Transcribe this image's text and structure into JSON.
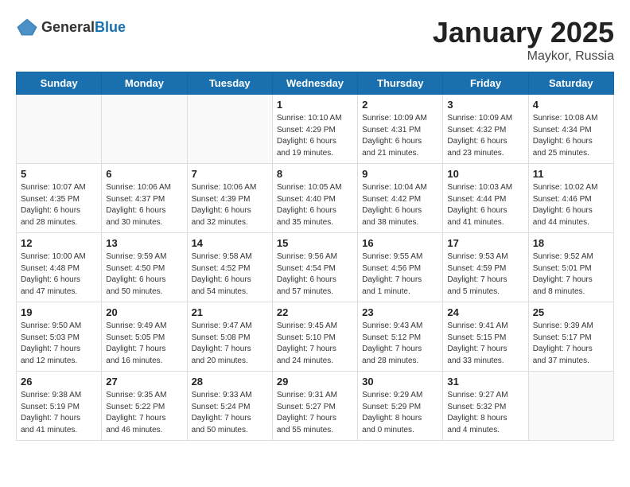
{
  "header": {
    "logo_general": "General",
    "logo_blue": "Blue",
    "title": "January 2025",
    "location": "Maykor, Russia"
  },
  "weekdays": [
    "Sunday",
    "Monday",
    "Tuesday",
    "Wednesday",
    "Thursday",
    "Friday",
    "Saturday"
  ],
  "weeks": [
    [
      {
        "day": "",
        "info": ""
      },
      {
        "day": "",
        "info": ""
      },
      {
        "day": "",
        "info": ""
      },
      {
        "day": "1",
        "info": "Sunrise: 10:10 AM\nSunset: 4:29 PM\nDaylight: 6 hours\nand 19 minutes."
      },
      {
        "day": "2",
        "info": "Sunrise: 10:09 AM\nSunset: 4:31 PM\nDaylight: 6 hours\nand 21 minutes."
      },
      {
        "day": "3",
        "info": "Sunrise: 10:09 AM\nSunset: 4:32 PM\nDaylight: 6 hours\nand 23 minutes."
      },
      {
        "day": "4",
        "info": "Sunrise: 10:08 AM\nSunset: 4:34 PM\nDaylight: 6 hours\nand 25 minutes."
      }
    ],
    [
      {
        "day": "5",
        "info": "Sunrise: 10:07 AM\nSunset: 4:35 PM\nDaylight: 6 hours\nand 28 minutes."
      },
      {
        "day": "6",
        "info": "Sunrise: 10:06 AM\nSunset: 4:37 PM\nDaylight: 6 hours\nand 30 minutes."
      },
      {
        "day": "7",
        "info": "Sunrise: 10:06 AM\nSunset: 4:39 PM\nDaylight: 6 hours\nand 32 minutes."
      },
      {
        "day": "8",
        "info": "Sunrise: 10:05 AM\nSunset: 4:40 PM\nDaylight: 6 hours\nand 35 minutes."
      },
      {
        "day": "9",
        "info": "Sunrise: 10:04 AM\nSunset: 4:42 PM\nDaylight: 6 hours\nand 38 minutes."
      },
      {
        "day": "10",
        "info": "Sunrise: 10:03 AM\nSunset: 4:44 PM\nDaylight: 6 hours\nand 41 minutes."
      },
      {
        "day": "11",
        "info": "Sunrise: 10:02 AM\nSunset: 4:46 PM\nDaylight: 6 hours\nand 44 minutes."
      }
    ],
    [
      {
        "day": "12",
        "info": "Sunrise: 10:00 AM\nSunset: 4:48 PM\nDaylight: 6 hours\nand 47 minutes."
      },
      {
        "day": "13",
        "info": "Sunrise: 9:59 AM\nSunset: 4:50 PM\nDaylight: 6 hours\nand 50 minutes."
      },
      {
        "day": "14",
        "info": "Sunrise: 9:58 AM\nSunset: 4:52 PM\nDaylight: 6 hours\nand 54 minutes."
      },
      {
        "day": "15",
        "info": "Sunrise: 9:56 AM\nSunset: 4:54 PM\nDaylight: 6 hours\nand 57 minutes."
      },
      {
        "day": "16",
        "info": "Sunrise: 9:55 AM\nSunset: 4:56 PM\nDaylight: 7 hours\nand 1 minute."
      },
      {
        "day": "17",
        "info": "Sunrise: 9:53 AM\nSunset: 4:59 PM\nDaylight: 7 hours\nand 5 minutes."
      },
      {
        "day": "18",
        "info": "Sunrise: 9:52 AM\nSunset: 5:01 PM\nDaylight: 7 hours\nand 8 minutes."
      }
    ],
    [
      {
        "day": "19",
        "info": "Sunrise: 9:50 AM\nSunset: 5:03 PM\nDaylight: 7 hours\nand 12 minutes."
      },
      {
        "day": "20",
        "info": "Sunrise: 9:49 AM\nSunset: 5:05 PM\nDaylight: 7 hours\nand 16 minutes."
      },
      {
        "day": "21",
        "info": "Sunrise: 9:47 AM\nSunset: 5:08 PM\nDaylight: 7 hours\nand 20 minutes."
      },
      {
        "day": "22",
        "info": "Sunrise: 9:45 AM\nSunset: 5:10 PM\nDaylight: 7 hours\nand 24 minutes."
      },
      {
        "day": "23",
        "info": "Sunrise: 9:43 AM\nSunset: 5:12 PM\nDaylight: 7 hours\nand 28 minutes."
      },
      {
        "day": "24",
        "info": "Sunrise: 9:41 AM\nSunset: 5:15 PM\nDaylight: 7 hours\nand 33 minutes."
      },
      {
        "day": "25",
        "info": "Sunrise: 9:39 AM\nSunset: 5:17 PM\nDaylight: 7 hours\nand 37 minutes."
      }
    ],
    [
      {
        "day": "26",
        "info": "Sunrise: 9:38 AM\nSunset: 5:19 PM\nDaylight: 7 hours\nand 41 minutes."
      },
      {
        "day": "27",
        "info": "Sunrise: 9:35 AM\nSunset: 5:22 PM\nDaylight: 7 hours\nand 46 minutes."
      },
      {
        "day": "28",
        "info": "Sunrise: 9:33 AM\nSunset: 5:24 PM\nDaylight: 7 hours\nand 50 minutes."
      },
      {
        "day": "29",
        "info": "Sunrise: 9:31 AM\nSunset: 5:27 PM\nDaylight: 7 hours\nand 55 minutes."
      },
      {
        "day": "30",
        "info": "Sunrise: 9:29 AM\nSunset: 5:29 PM\nDaylight: 8 hours\nand 0 minutes."
      },
      {
        "day": "31",
        "info": "Sunrise: 9:27 AM\nSunset: 5:32 PM\nDaylight: 8 hours\nand 4 minutes."
      },
      {
        "day": "",
        "info": ""
      }
    ]
  ]
}
